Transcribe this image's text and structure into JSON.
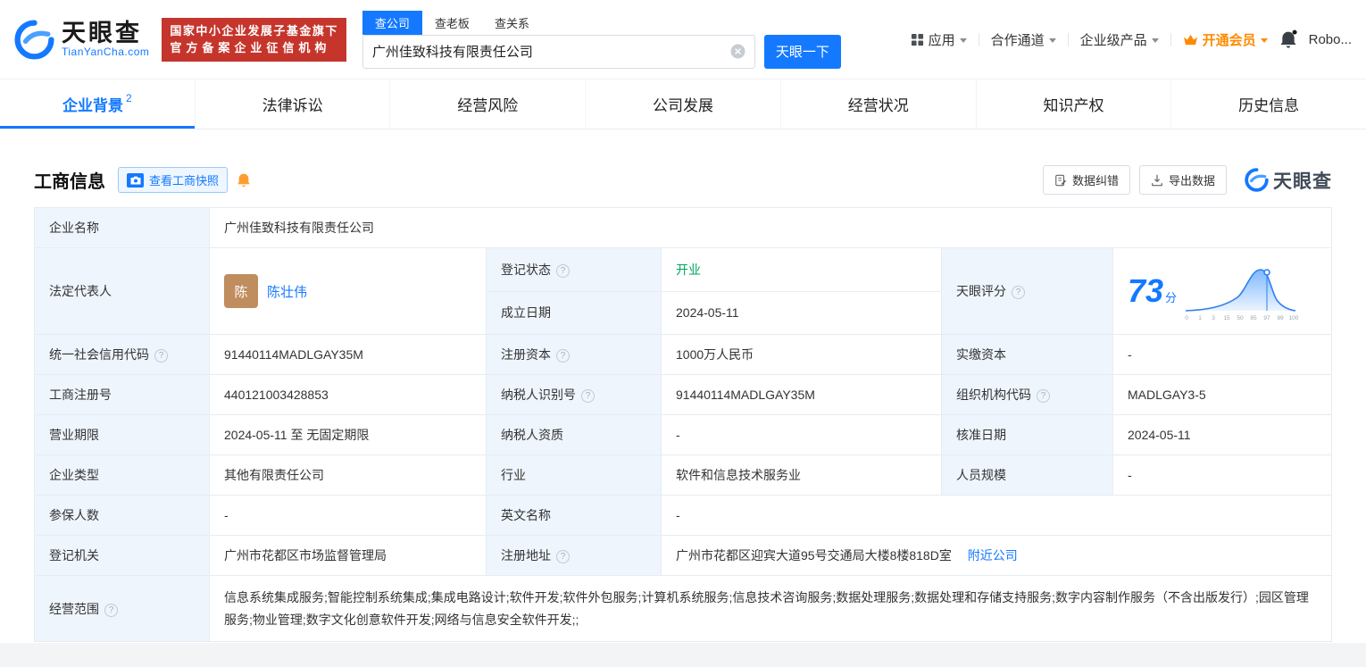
{
  "header": {
    "brand": "天眼查",
    "brand_domain": "TianYanCha.com",
    "badge_line1": "国家中小企业发展子基金旗下",
    "badge_line2": "官方备案企业征信机构",
    "search_tabs": [
      {
        "label": "查公司"
      },
      {
        "label": "查老板"
      },
      {
        "label": "查关系"
      }
    ],
    "search_value": "广州佳致科技有限责任公司",
    "search_button": "天眼一下",
    "nav_items": [
      {
        "label": "应用"
      },
      {
        "label": "合作通道"
      },
      {
        "label": "企业级产品"
      },
      {
        "label": "开通会员"
      }
    ],
    "user_name": "Robo..."
  },
  "nav_tabs": [
    {
      "label": "企业背景",
      "badge": "2"
    },
    {
      "label": "法律诉讼"
    },
    {
      "label": "经营风险"
    },
    {
      "label": "公司发展"
    },
    {
      "label": "经营状况"
    },
    {
      "label": "知识产权"
    },
    {
      "label": "历史信息"
    }
  ],
  "toolbar": {
    "section_title": "工商信息",
    "snapshot_button": "查看工商快照",
    "correction_button": "数据纠错",
    "export_button": "导出数据",
    "brand_watermark": "天眼查"
  },
  "info": {
    "company_name_label": "企业名称",
    "company_name": "广州佳致科技有限责任公司",
    "legal_rep_label": "法定代表人",
    "legal_rep_avatar": "陈",
    "legal_rep_name": "陈壮伟",
    "status_label": "登记状态",
    "status_value": "开业",
    "established_label": "成立日期",
    "established_value": "2024-05-11",
    "score_label": "天眼评分",
    "score_value": "73",
    "score_unit": "分",
    "credit_code_label": "统一社会信用代码",
    "credit_code": "91440114MADLGAY35M",
    "reg_capital_label": "注册资本",
    "reg_capital": "1000万人民币",
    "paid_capital_label": "实缴资本",
    "paid_capital": "-",
    "reg_number_label": "工商注册号",
    "reg_number": "440121003428853",
    "taxpayer_id_label": "纳税人识别号",
    "taxpayer_id": "91440114MADLGAY35M",
    "org_code_label": "组织机构代码",
    "org_code": "MADLGAY3-5",
    "business_term_label": "营业期限",
    "business_term": "2024-05-11 至 无固定期限",
    "taxpayer_quality_label": "纳税人资质",
    "taxpayer_quality": "-",
    "approval_date_label": "核准日期",
    "approval_date": "2024-05-11",
    "company_type_label": "企业类型",
    "company_type": "其他有限责任公司",
    "industry_label": "行业",
    "industry": "软件和信息技术服务业",
    "staff_size_label": "人员规模",
    "staff_size": "-",
    "insured_label": "参保人数",
    "insured": "-",
    "english_name_label": "英文名称",
    "english_name": "-",
    "registry_label": "登记机关",
    "registry": "广州市花都区市场监督管理局",
    "address_label": "注册地址",
    "address": "广州市花都区迎宾大道95号交通局大楼8楼818D室",
    "nearby_link": "附近公司",
    "scope_label": "经营范围",
    "scope": "信息系统集成服务;智能控制系统集成;集成电路设计;软件开发;软件外包服务;计算机系统服务;信息技术咨询服务;数据处理服务;数据处理和存储支持服务;数字内容制作服务（不含出版发行）;园区管理服务;物业管理;数字文化创意软件开发;网络与信息安全软件开发;;"
  },
  "chart_data": {
    "type": "area",
    "title": "天眼评分分布曲线",
    "score_marker": 73,
    "x_ticks": [
      "0",
      "1",
      "3",
      "15",
      "50",
      "85",
      "97",
      "99",
      "100"
    ],
    "legend_position": "none",
    "grid": false
  },
  "icons": {
    "help": "?"
  },
  "colors": {
    "primary": "#1479ff",
    "status_green": "#00a65b",
    "vip_orange": "#ff8a00",
    "badge_red": "#c5352c",
    "label_cell_bg": "#eef5fd"
  }
}
